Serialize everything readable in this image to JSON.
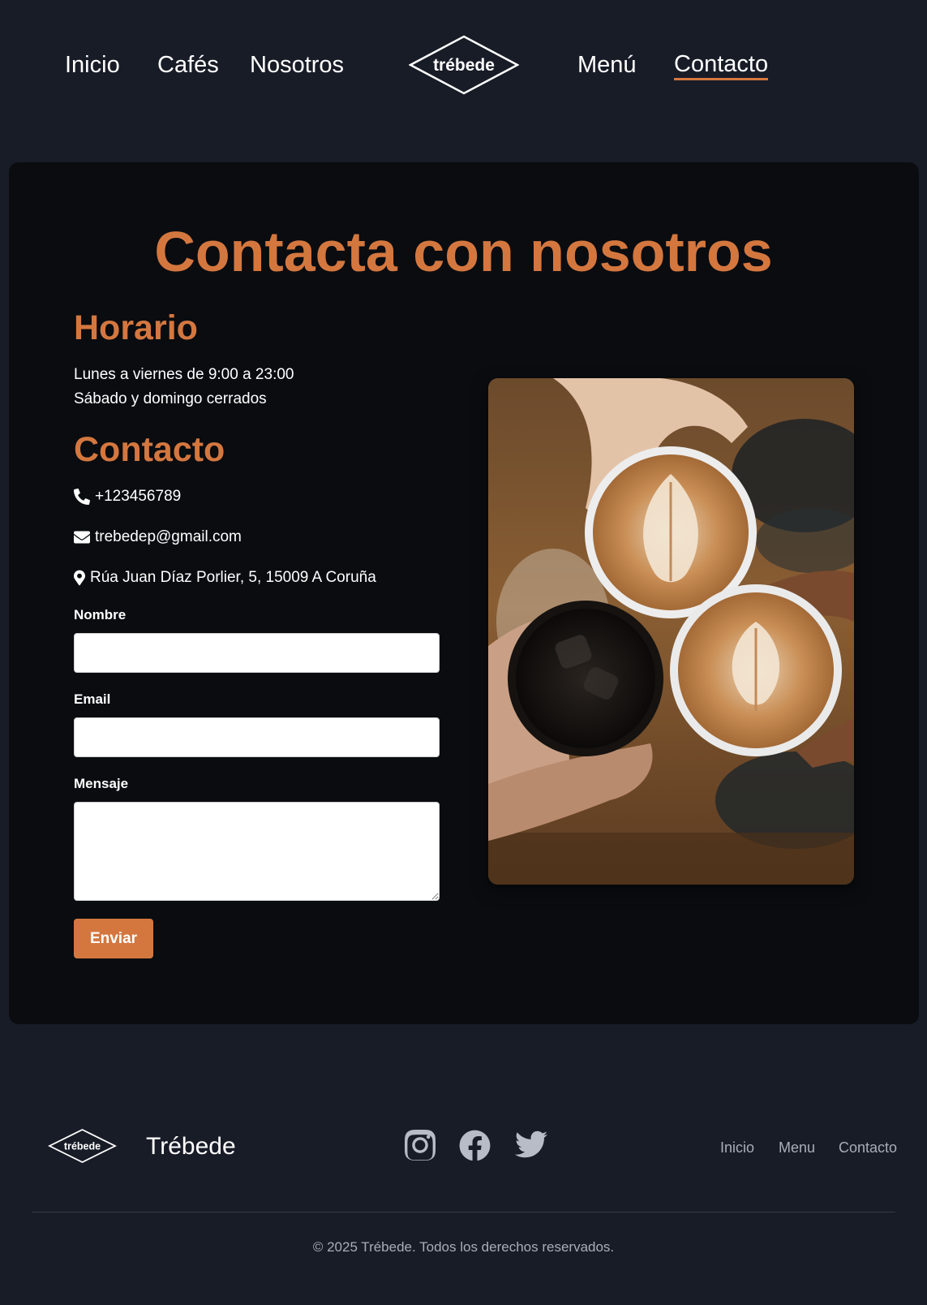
{
  "nav": {
    "links": [
      {
        "label": "Inicio"
      },
      {
        "label": "Cafés"
      },
      {
        "label": "Nosotros"
      },
      {
        "label": "Menú"
      },
      {
        "label": "Contacto",
        "active": true
      }
    ],
    "logo_text": "trébede"
  },
  "main": {
    "title": "Contacta con nosotros",
    "schedule": {
      "heading": "Horario",
      "lines": [
        "Lunes a viernes de 9:00 a 23:00",
        "Sábado y domingo cerrados"
      ]
    },
    "contact": {
      "heading": "Contacto",
      "phone": {
        "icon": "phone-icon",
        "value": "+123456789"
      },
      "email": {
        "icon": "envelope-icon",
        "value": "trebedep@gmail.com"
      },
      "address": {
        "icon": "map-pin-icon",
        "value": "Rúa Juan Díaz Porlier, 5, 15009 A Coruña"
      }
    },
    "form": {
      "name_label": "Nombre",
      "name_value": "",
      "email_label": "Email",
      "email_value": "",
      "message_label": "Mensaje",
      "message_value": "",
      "submit_label": "Enviar"
    },
    "photo": {
      "subject": "three-cups-coffee-toast"
    }
  },
  "footer": {
    "logo_text": "trébede",
    "brand": "Trébede",
    "social": [
      "instagram-icon",
      "facebook-icon",
      "twitter-icon"
    ],
    "links": [
      {
        "label": "Inicio"
      },
      {
        "label": "Menu"
      },
      {
        "label": "Contacto"
      }
    ],
    "copyright": "© 2025 Trébede. Todos los derechos reservados."
  },
  "colors": {
    "background": "#181c27",
    "card": "#0a0c10",
    "accent": "#d4773f",
    "text": "#ffffff",
    "muted": "#a8adb7"
  }
}
